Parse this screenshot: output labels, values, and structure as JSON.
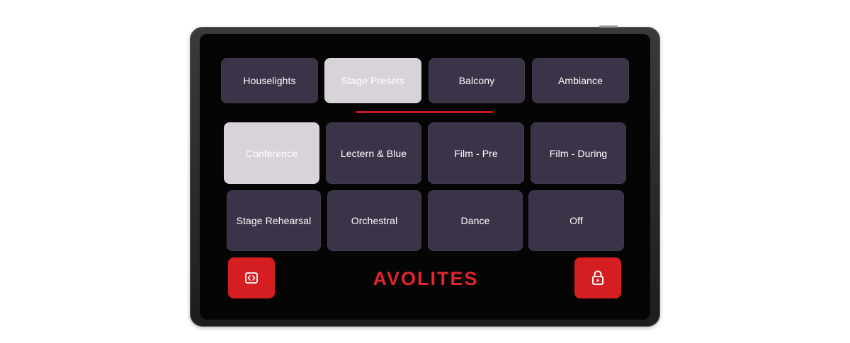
{
  "tabs": [
    {
      "label": "Houselights",
      "active": false
    },
    {
      "label": "Stage Presets",
      "active": true
    },
    {
      "label": "Balcony",
      "active": false
    },
    {
      "label": "Ambiance",
      "active": false
    }
  ],
  "presets": [
    {
      "label": "Conference",
      "active": true
    },
    {
      "label": "Lectern & Blue",
      "active": false
    },
    {
      "label": "Film - Pre",
      "active": false
    },
    {
      "label": "Film - During",
      "active": false
    },
    {
      "label": "Stage Rehearsal",
      "active": false
    },
    {
      "label": "Orchestral",
      "active": false
    },
    {
      "label": "Dance",
      "active": false
    },
    {
      "label": "Off",
      "active": false
    }
  ],
  "footer": {
    "brand": "AVOLITES",
    "left_button_icon": "code-brackets-icon",
    "right_button_icon": "lock-icon"
  },
  "colors": {
    "accent": "#d41e22",
    "tile": "#3b3448",
    "tile_active": "#d7d3d9",
    "brand": "#e0262a"
  }
}
